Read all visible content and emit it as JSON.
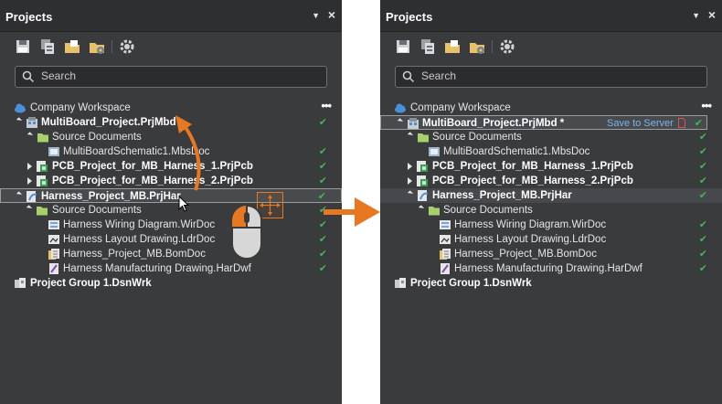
{
  "left_panel": {
    "title": "Projects",
    "search_placeholder": "Search",
    "workspace": "Company Workspace",
    "items": [
      {
        "label": "MultiBoard_Project.PrjMbd",
        "bold": true,
        "status": "✔"
      },
      {
        "label": "Source Documents",
        "bold": false,
        "status": ""
      },
      {
        "label": "MultiBoardSchematic1.MbsDoc",
        "bold": false,
        "status": "✔"
      },
      {
        "label": "PCB_Project_for_MB_Harness_1.PrjPcb",
        "bold": true,
        "status": "✔"
      },
      {
        "label": "PCB_Project_for_MB_Harness_2.PrjPcb",
        "bold": true,
        "status": "✔"
      },
      {
        "label": "Harness_Project_MB.PrjHar",
        "bold": true,
        "status": "✔"
      },
      {
        "label": "Source Documents",
        "bold": false,
        "status": "✔"
      },
      {
        "label": "Harness Wiring Diagram.WirDoc",
        "bold": false,
        "status": "✔"
      },
      {
        "label": "Harness Layout Drawing.LdrDoc",
        "bold": false,
        "status": "✔"
      },
      {
        "label": "Harness_Project_MB.BomDoc",
        "bold": false,
        "status": "✔"
      },
      {
        "label": "Harness Manufacturing Drawing.HarDwf",
        "bold": false,
        "status": "✔"
      },
      {
        "label": "Project Group 1.DsnWrk",
        "bold": true,
        "status": ""
      }
    ]
  },
  "right_panel": {
    "title": "Projects",
    "search_placeholder": "Search",
    "workspace": "Company Workspace",
    "save_to_server": "Save to Server",
    "items": [
      {
        "label": "MultiBoard_Project.PrjMbd *",
        "bold": true,
        "status": "✔"
      },
      {
        "label": "Source Documents",
        "bold": false,
        "status": "✔"
      },
      {
        "label": "MultiBoardSchematic1.MbsDoc",
        "bold": false,
        "status": "✔"
      },
      {
        "label": "PCB_Project_for_MB_Harness_1.PrjPcb",
        "bold": true,
        "status": "✔"
      },
      {
        "label": "PCB_Project_for_MB_Harness_2.PrjPcb",
        "bold": true,
        "status": "✔"
      },
      {
        "label": "Harness_Project_MB.PrjHar",
        "bold": true,
        "status": "✔"
      },
      {
        "label": "Source Documents",
        "bold": false,
        "status": ""
      },
      {
        "label": "Harness Wiring Diagram.WirDoc",
        "bold": false,
        "status": "✔"
      },
      {
        "label": "Harness Layout Drawing.LdrDoc",
        "bold": false,
        "status": "✔"
      },
      {
        "label": "Harness_Project_MB.BomDoc",
        "bold": false,
        "status": "✔"
      },
      {
        "label": "Harness Manufacturing Drawing.HarDwf",
        "bold": false,
        "status": "✔"
      },
      {
        "label": "Project Group 1.DsnWrk",
        "bold": true,
        "status": ""
      }
    ]
  },
  "colors": {
    "panel_bg": "#393b3d",
    "titlebar_bg": "#2d2f31",
    "check_green": "#3dbb4b",
    "accent_orange": "#e87722",
    "link_blue": "#7fb3e8"
  }
}
